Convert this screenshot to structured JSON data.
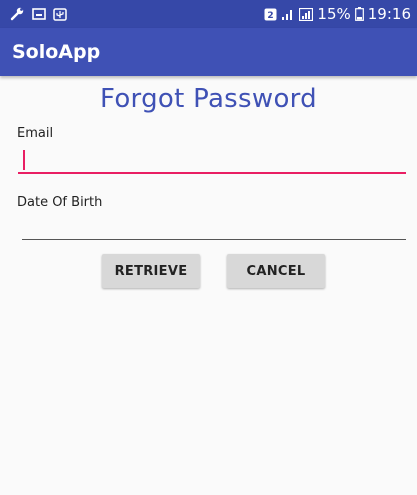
{
  "status_bar": {
    "battery_text": "15%",
    "time": "19:16",
    "icons": [
      "wrench-icon",
      "screen-icon",
      "usb-icon",
      "sim-icon",
      "signal-icon",
      "signal2-icon",
      "battery-icon"
    ]
  },
  "app_bar": {
    "title": "SoloApp"
  },
  "page": {
    "title": "Forgot Password"
  },
  "form": {
    "email_label": "Email",
    "email_value": "",
    "dob_label": "Date Of Birth",
    "dob_value": ""
  },
  "buttons": {
    "retrieve_label": "RETRIEVE",
    "cancel_label": "CANCEL"
  },
  "colors": {
    "primary": "#3f51b5",
    "primary_dark": "#3648a8",
    "accent": "#e91e63"
  }
}
